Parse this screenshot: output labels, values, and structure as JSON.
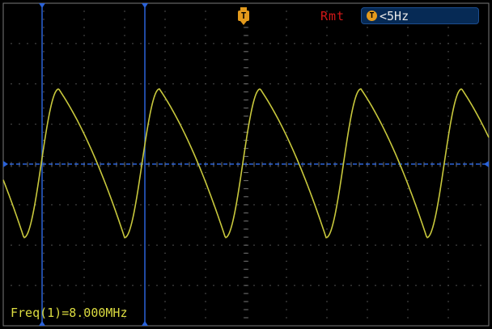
{
  "header": {
    "trigger_marker_label": "T",
    "trigger_mode": "Rmt",
    "trigger_status_icon": "T",
    "trigger_status_text": "<5Hz"
  },
  "measurement": {
    "text": "Freq(1)=8.000MHz"
  },
  "colors": {
    "trace": "#c8c83c",
    "grid": "#6e6e6e",
    "cursor": "#2a62d8",
    "trigger": "#e39a1c",
    "mode_label": "#d01818"
  }
}
